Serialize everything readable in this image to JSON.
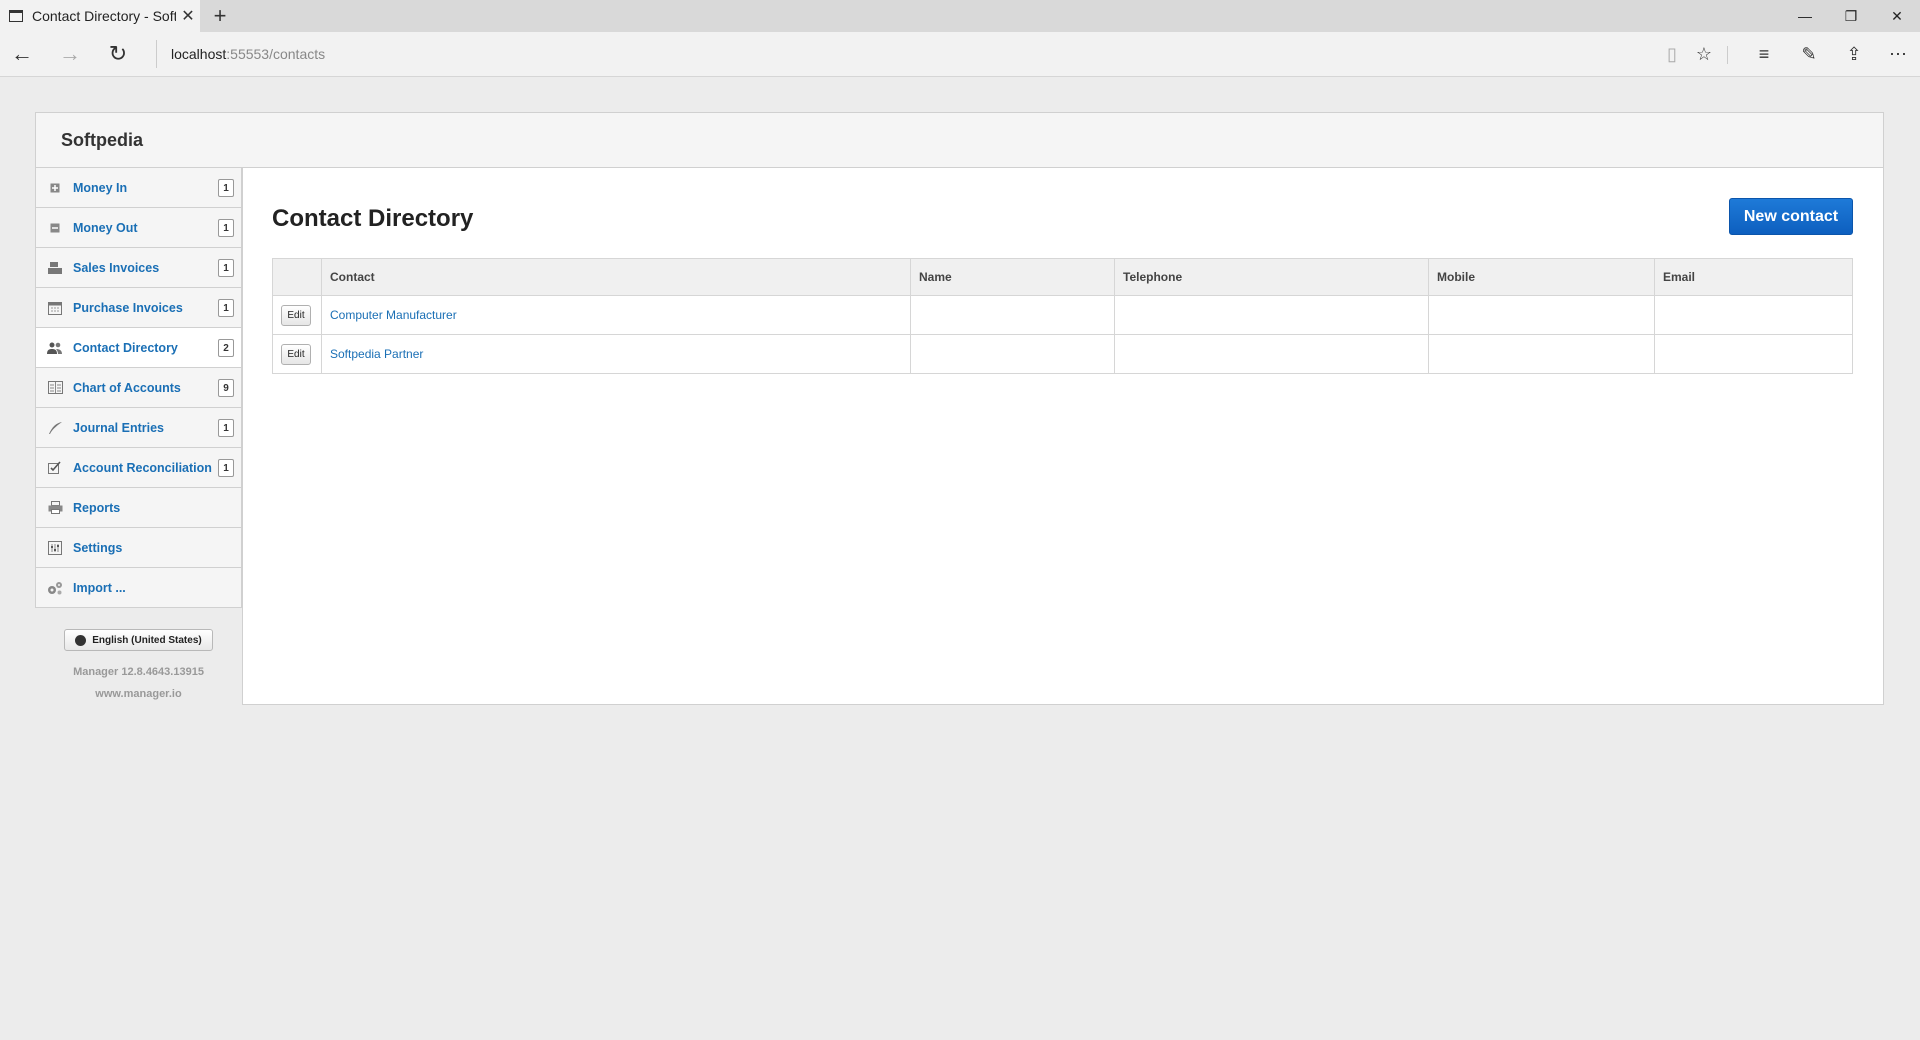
{
  "browser": {
    "tab_title": "Contact Directory - Soft",
    "url_host": "localhost",
    "url_path": ":55553/contacts"
  },
  "app": {
    "brand": "Softpedia",
    "page_title": "Contact Directory",
    "new_button": "New contact"
  },
  "sidebar": {
    "items": [
      {
        "label": "Money In",
        "badge": "1",
        "icon": "plus-square-icon"
      },
      {
        "label": "Money Out",
        "badge": "1",
        "icon": "minus-square-icon"
      },
      {
        "label": "Sales Invoices",
        "badge": "1",
        "icon": "cash-register-icon"
      },
      {
        "label": "Purchase Invoices",
        "badge": "1",
        "icon": "calendar-icon"
      },
      {
        "label": "Contact Directory",
        "badge": "2",
        "icon": "users-icon"
      },
      {
        "label": "Chart of Accounts",
        "badge": "9",
        "icon": "ledger-icon"
      },
      {
        "label": "Journal Entries",
        "badge": "1",
        "icon": "quill-icon"
      },
      {
        "label": "Account Reconciliation",
        "badge": "1",
        "icon": "checkbox-icon"
      },
      {
        "label": "Reports",
        "badge": "",
        "icon": "printer-icon"
      },
      {
        "label": "Settings",
        "badge": "",
        "icon": "settings-icon"
      },
      {
        "label": "Import ...",
        "badge": "",
        "icon": "gears-icon"
      }
    ],
    "language": "English (United States)",
    "version": "Manager 12.8.4643.13915",
    "site": "www.manager.io"
  },
  "table": {
    "columns": [
      "",
      "Contact",
      "Name",
      "Telephone",
      "Mobile",
      "Email"
    ],
    "edit_label": "Edit",
    "rows": [
      {
        "contact": "Computer Manufacturer",
        "name": "",
        "telephone": "",
        "mobile": "",
        "email": ""
      },
      {
        "contact": "Softpedia Partner",
        "name": "",
        "telephone": "",
        "mobile": "",
        "email": ""
      }
    ]
  }
}
